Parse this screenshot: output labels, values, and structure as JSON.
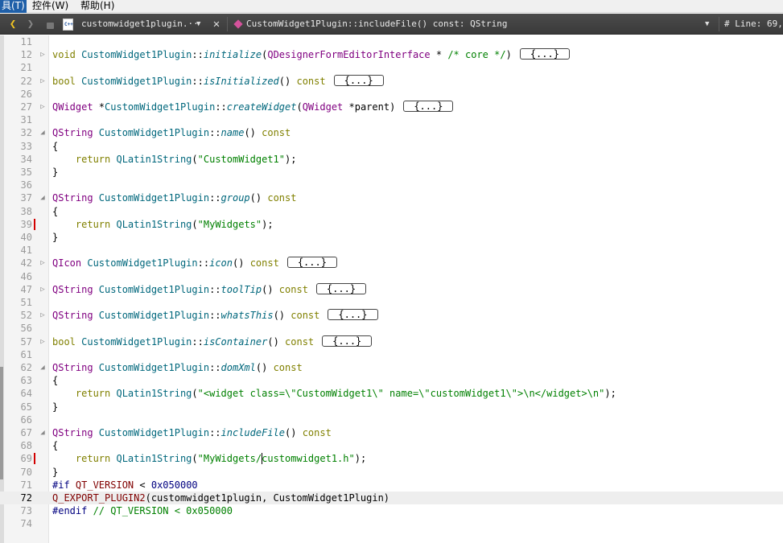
{
  "menubar": {
    "items": [
      {
        "label": "具(T)",
        "active": true
      },
      {
        "label": "控件(W)",
        "active": false
      },
      {
        "label": "帮助(H)",
        "active": false
      }
    ]
  },
  "toolbar": {
    "file_icon_text": "C++",
    "file_name": "customwidget1plugin.···*",
    "current_symbol": "CustomWidget1Plugin::includeFile() const: QString",
    "line_info": "#  Line: 69,"
  },
  "editor": {
    "folded_label": "{...}",
    "current_line": "72",
    "lines": [
      {
        "num": "11",
        "fold": "",
        "mark": false,
        "segs": []
      },
      {
        "num": "12",
        "fold": "▷",
        "mark": false,
        "segs": [
          {
            "c": "kw",
            "t": "void "
          },
          {
            "c": "fn",
            "t": "CustomWidget1Plugin"
          },
          {
            "c": "",
            "t": "::"
          },
          {
            "c": "it",
            "t": "initialize"
          },
          {
            "c": "",
            "t": "("
          },
          {
            "c": "ty",
            "t": "QDesignerFormEditorInterface"
          },
          {
            "c": "",
            "t": " * "
          },
          {
            "c": "cm",
            "t": "/* core */"
          },
          {
            "c": "",
            "t": ")"
          },
          {
            "c": "box",
            "t": "{...}"
          }
        ]
      },
      {
        "num": "21",
        "fold": "",
        "mark": false,
        "segs": []
      },
      {
        "num": "22",
        "fold": "▷",
        "mark": false,
        "segs": [
          {
            "c": "kw",
            "t": "bool "
          },
          {
            "c": "fn",
            "t": "CustomWidget1Plugin"
          },
          {
            "c": "",
            "t": "::"
          },
          {
            "c": "it",
            "t": "isInitialized"
          },
          {
            "c": "",
            "t": "() "
          },
          {
            "c": "kw",
            "t": "const"
          },
          {
            "c": "box",
            "t": "{...}"
          }
        ]
      },
      {
        "num": "26",
        "fold": "",
        "mark": false,
        "segs": []
      },
      {
        "num": "27",
        "fold": "▷",
        "mark": false,
        "segs": [
          {
            "c": "ty",
            "t": "QWidget"
          },
          {
            "c": "",
            "t": " *"
          },
          {
            "c": "fn",
            "t": "CustomWidget1Plugin"
          },
          {
            "c": "",
            "t": "::"
          },
          {
            "c": "it",
            "t": "createWidget"
          },
          {
            "c": "",
            "t": "("
          },
          {
            "c": "ty",
            "t": "QWidget"
          },
          {
            "c": "",
            "t": " *parent)"
          },
          {
            "c": "box",
            "t": "{...}"
          }
        ]
      },
      {
        "num": "31",
        "fold": "",
        "mark": false,
        "segs": []
      },
      {
        "num": "32",
        "fold": "◢",
        "mark": false,
        "segs": [
          {
            "c": "ty",
            "t": "QString "
          },
          {
            "c": "fn",
            "t": "CustomWidget1Plugin"
          },
          {
            "c": "",
            "t": "::"
          },
          {
            "c": "it",
            "t": "name"
          },
          {
            "c": "",
            "t": "() "
          },
          {
            "c": "kw",
            "t": "const"
          }
        ]
      },
      {
        "num": "33",
        "fold": "",
        "mark": false,
        "segs": [
          {
            "c": "",
            "t": "{"
          }
        ]
      },
      {
        "num": "34",
        "fold": "",
        "mark": false,
        "segs": [
          {
            "c": "",
            "t": "    "
          },
          {
            "c": "kw",
            "t": "return "
          },
          {
            "c": "fn",
            "t": "QLatin1String"
          },
          {
            "c": "",
            "t": "("
          },
          {
            "c": "st",
            "t": "\"CustomWidget1\""
          },
          {
            "c": "",
            "t": ");"
          }
        ]
      },
      {
        "num": "35",
        "fold": "",
        "mark": false,
        "segs": [
          {
            "c": "",
            "t": "}"
          }
        ]
      },
      {
        "num": "36",
        "fold": "",
        "mark": false,
        "segs": []
      },
      {
        "num": "37",
        "fold": "◢",
        "mark": false,
        "segs": [
          {
            "c": "ty",
            "t": "QString "
          },
          {
            "c": "fn",
            "t": "CustomWidget1Plugin"
          },
          {
            "c": "",
            "t": "::"
          },
          {
            "c": "it",
            "t": "group"
          },
          {
            "c": "",
            "t": "() "
          },
          {
            "c": "kw",
            "t": "const"
          }
        ]
      },
      {
        "num": "38",
        "fold": "",
        "mark": false,
        "segs": [
          {
            "c": "",
            "t": "{"
          }
        ]
      },
      {
        "num": "39",
        "fold": "",
        "mark": true,
        "segs": [
          {
            "c": "",
            "t": "    "
          },
          {
            "c": "kw",
            "t": "return "
          },
          {
            "c": "fn",
            "t": "QLatin1String"
          },
          {
            "c": "",
            "t": "("
          },
          {
            "c": "st",
            "t": "\"MyWidgets\""
          },
          {
            "c": "",
            "t": ");"
          }
        ]
      },
      {
        "num": "40",
        "fold": "",
        "mark": false,
        "segs": [
          {
            "c": "",
            "t": "}"
          }
        ]
      },
      {
        "num": "41",
        "fold": "",
        "mark": false,
        "segs": []
      },
      {
        "num": "42",
        "fold": "▷",
        "mark": false,
        "segs": [
          {
            "c": "ty",
            "t": "QIcon "
          },
          {
            "c": "fn",
            "t": "CustomWidget1Plugin"
          },
          {
            "c": "",
            "t": "::"
          },
          {
            "c": "it",
            "t": "icon"
          },
          {
            "c": "",
            "t": "() "
          },
          {
            "c": "kw",
            "t": "const"
          },
          {
            "c": "box",
            "t": "{...}"
          }
        ]
      },
      {
        "num": "46",
        "fold": "",
        "mark": false,
        "segs": []
      },
      {
        "num": "47",
        "fold": "▷",
        "mark": false,
        "segs": [
          {
            "c": "ty",
            "t": "QString "
          },
          {
            "c": "fn",
            "t": "CustomWidget1Plugin"
          },
          {
            "c": "",
            "t": "::"
          },
          {
            "c": "it",
            "t": "toolTip"
          },
          {
            "c": "",
            "t": "() "
          },
          {
            "c": "kw",
            "t": "const"
          },
          {
            "c": "box",
            "t": "{...}"
          }
        ]
      },
      {
        "num": "51",
        "fold": "",
        "mark": false,
        "segs": []
      },
      {
        "num": "52",
        "fold": "▷",
        "mark": false,
        "segs": [
          {
            "c": "ty",
            "t": "QString "
          },
          {
            "c": "fn",
            "t": "CustomWidget1Plugin"
          },
          {
            "c": "",
            "t": "::"
          },
          {
            "c": "it",
            "t": "whatsThis"
          },
          {
            "c": "",
            "t": "() "
          },
          {
            "c": "kw",
            "t": "const"
          },
          {
            "c": "box",
            "t": "{...}"
          }
        ]
      },
      {
        "num": "56",
        "fold": "",
        "mark": false,
        "segs": []
      },
      {
        "num": "57",
        "fold": "▷",
        "mark": false,
        "segs": [
          {
            "c": "kw",
            "t": "bool "
          },
          {
            "c": "fn",
            "t": "CustomWidget1Plugin"
          },
          {
            "c": "",
            "t": "::"
          },
          {
            "c": "it",
            "t": "isContainer"
          },
          {
            "c": "",
            "t": "() "
          },
          {
            "c": "kw",
            "t": "const"
          },
          {
            "c": "box",
            "t": "{...}"
          }
        ]
      },
      {
        "num": "61",
        "fold": "",
        "mark": false,
        "segs": []
      },
      {
        "num": "62",
        "fold": "◢",
        "mark": false,
        "segs": [
          {
            "c": "ty",
            "t": "QString "
          },
          {
            "c": "fn",
            "t": "CustomWidget1Plugin"
          },
          {
            "c": "",
            "t": "::"
          },
          {
            "c": "it",
            "t": "domXml"
          },
          {
            "c": "",
            "t": "() "
          },
          {
            "c": "kw",
            "t": "const"
          }
        ]
      },
      {
        "num": "63",
        "fold": "",
        "mark": false,
        "segs": [
          {
            "c": "",
            "t": "{"
          }
        ]
      },
      {
        "num": "64",
        "fold": "",
        "mark": false,
        "segs": [
          {
            "c": "",
            "t": "    "
          },
          {
            "c": "kw",
            "t": "return "
          },
          {
            "c": "fn",
            "t": "QLatin1String"
          },
          {
            "c": "",
            "t": "("
          },
          {
            "c": "st",
            "t": "\"<widget class=\\\"CustomWidget1\\\" name=\\\"customWidget1\\\">\\n</widget>\\n\""
          },
          {
            "c": "",
            "t": ");"
          }
        ]
      },
      {
        "num": "65",
        "fold": "",
        "mark": false,
        "segs": [
          {
            "c": "",
            "t": "}"
          }
        ]
      },
      {
        "num": "66",
        "fold": "",
        "mark": false,
        "segs": []
      },
      {
        "num": "67",
        "fold": "◢",
        "mark": false,
        "segs": [
          {
            "c": "ty",
            "t": "QString "
          },
          {
            "c": "fn",
            "t": "CustomWidget1Plugin"
          },
          {
            "c": "",
            "t": "::"
          },
          {
            "c": "it",
            "t": "includeFile"
          },
          {
            "c": "",
            "t": "() "
          },
          {
            "c": "kw",
            "t": "const"
          }
        ]
      },
      {
        "num": "68",
        "fold": "",
        "mark": false,
        "segs": [
          {
            "c": "",
            "t": "{"
          }
        ]
      },
      {
        "num": "69",
        "fold": "",
        "mark": true,
        "segs": [
          {
            "c": "",
            "t": "    "
          },
          {
            "c": "kw",
            "t": "return "
          },
          {
            "c": "fn",
            "t": "QLatin1String"
          },
          {
            "c": "",
            "t": "("
          },
          {
            "c": "st",
            "t": "\"MyWidgets/"
          },
          {
            "c": "cursor",
            "t": ""
          },
          {
            "c": "st",
            "t": "customwidget1.h\""
          },
          {
            "c": "",
            "t": ");"
          }
        ]
      },
      {
        "num": "70",
        "fold": "",
        "mark": false,
        "segs": [
          {
            "c": "",
            "t": "}"
          }
        ]
      },
      {
        "num": "71",
        "fold": "",
        "mark": false,
        "segs": [
          {
            "c": "pp",
            "t": "#if "
          },
          {
            "c": "mc",
            "t": "QT_VERSION"
          },
          {
            "c": "",
            "t": " < "
          },
          {
            "c": "nm",
            "t": "0x050000"
          }
        ]
      },
      {
        "num": "72",
        "fold": "",
        "mark": false,
        "segs": [
          {
            "c": "mc",
            "t": "Q_EXPORT_PLUGIN2"
          },
          {
            "c": "",
            "t": "(customwidget1plugin, CustomWidget1Plugin)"
          }
        ]
      },
      {
        "num": "73",
        "fold": "",
        "mark": false,
        "segs": [
          {
            "c": "pp",
            "t": "#endif "
          },
          {
            "c": "cm",
            "t": "// QT_VERSION < 0x050000"
          }
        ]
      },
      {
        "num": "74",
        "fold": "",
        "mark": false,
        "segs": []
      }
    ]
  }
}
